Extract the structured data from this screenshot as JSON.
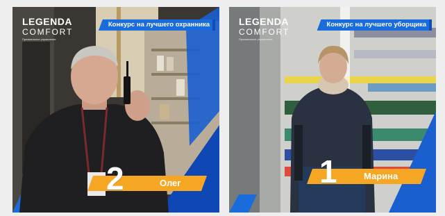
{
  "brand": {
    "name": "LEGENDA",
    "sub": "COMFORT",
    "tagline": "Премиальное управление"
  },
  "colors": {
    "accent_blue": "#1a6bdc",
    "ribbon_orange": "#f5a623",
    "text_white": "#ffffff"
  },
  "cards": [
    {
      "contest": "Конкурс на лучшего охранника",
      "place": "2",
      "name": "Олег"
    },
    {
      "contest": "Конкурс на лучшего уборщика",
      "place": "1",
      "name": "Марина"
    }
  ]
}
